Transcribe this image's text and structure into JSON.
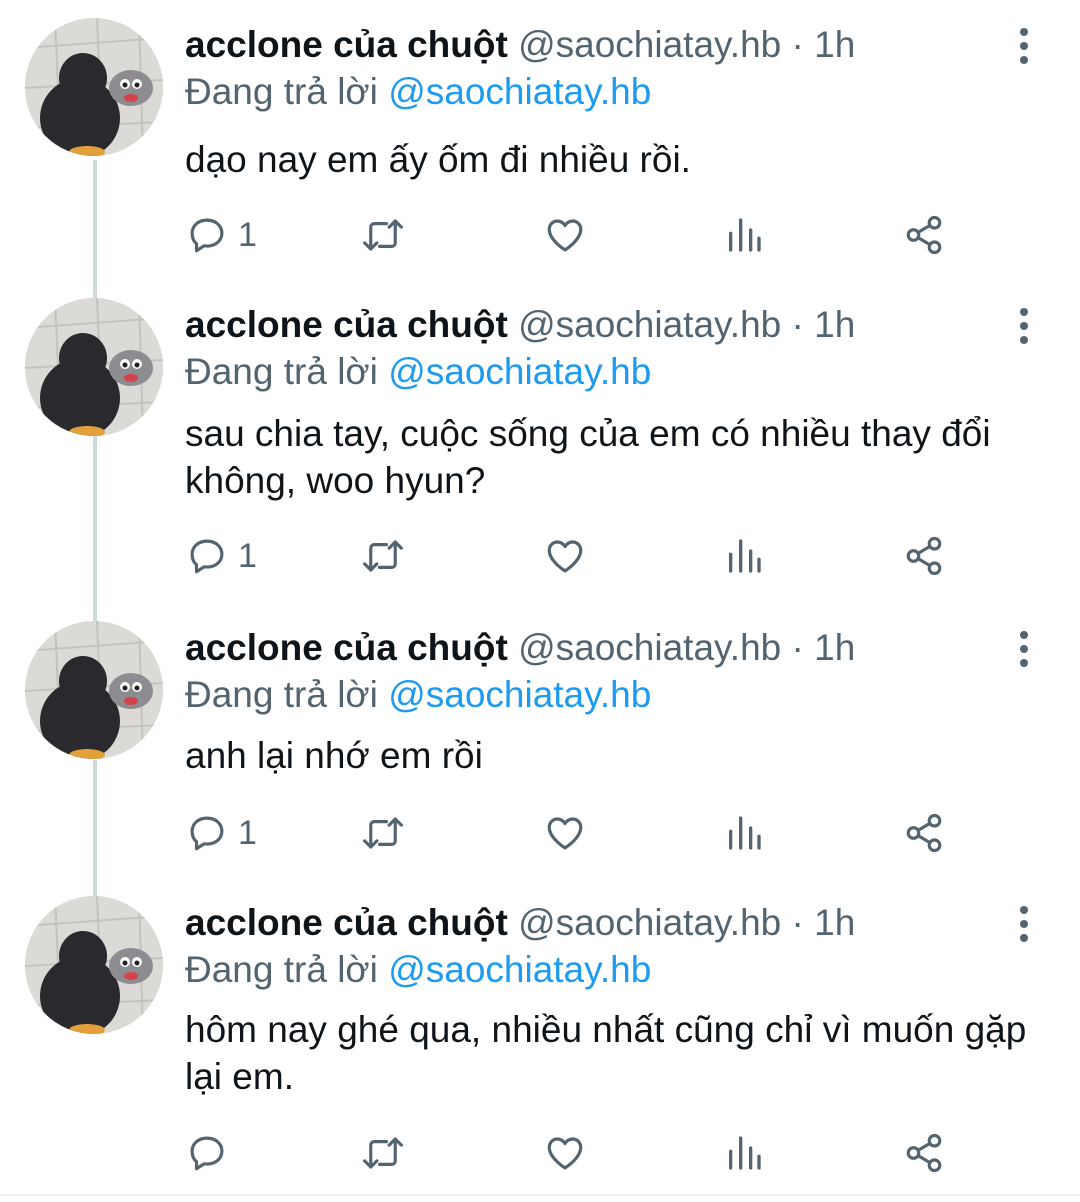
{
  "tweets": [
    {
      "name": "acclone của chuột",
      "handle": "@saochiatay.hb",
      "separator": "·",
      "time": "1h",
      "replying_prefix": "Đang trả lời ",
      "replying_to": "@saochiatay.hb",
      "text": "dạo nay em ấy ốm đi nhiều rồi.",
      "reply_count": "1"
    },
    {
      "name": "acclone của chuột",
      "handle": "@saochiatay.hb",
      "separator": "·",
      "time": "1h",
      "replying_prefix": "Đang trả lời ",
      "replying_to": "@saochiatay.hb",
      "text": "sau chia tay, cuộc sống của em có nhiều thay đổi không, woo hyun?",
      "reply_count": "1"
    },
    {
      "name": "acclone của chuột",
      "handle": "@saochiatay.hb",
      "separator": "·",
      "time": "1h",
      "replying_prefix": "Đang trả lời ",
      "replying_to": "@saochiatay.hb",
      "text": "anh lại nhớ em rồi",
      "reply_count": "1"
    },
    {
      "name": "acclone của chuột",
      "handle": "@saochiatay.hb",
      "separator": "·",
      "time": "1h",
      "replying_prefix": "Đang trả lời ",
      "replying_to": "@saochiatay.hb",
      "text": "hôm nay ghé qua, nhiều nhất cũng chỉ vì muốn gặp lại em.",
      "reply_count": ""
    }
  ],
  "icons": {
    "reply": "reply-icon",
    "retweet": "retweet-icon",
    "like": "heart-icon",
    "views": "views-icon",
    "share": "share-icon",
    "more": "more-vertical-icon",
    "avatar": "penguin-avatar"
  },
  "colors": {
    "text": "#0f1419",
    "secondary": "#536471",
    "accent": "#1d9bf0",
    "thread_line": "#cfd9de"
  }
}
